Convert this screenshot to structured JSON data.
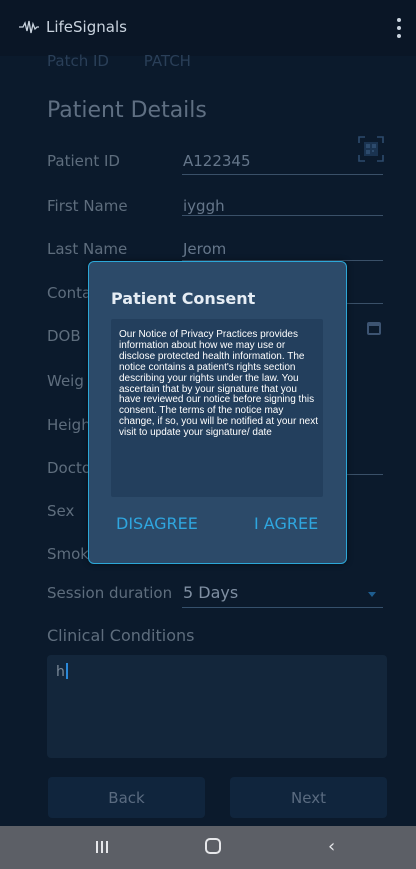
{
  "app": {
    "title": "LifeSignals",
    "logo_icon": "waveform-icon",
    "menu_icon": "more-vert-icon"
  },
  "patch": {
    "label": "Patch ID",
    "value": "PATCH"
  },
  "form": {
    "section_title": "Patient Details",
    "fields": [
      {
        "label": "Patient ID",
        "value": "A122345"
      },
      {
        "label": "First Name",
        "value": "iyggh"
      },
      {
        "label": "Last Name",
        "value": "Jerom"
      },
      {
        "label": "Conta",
        "value": ""
      },
      {
        "label": "DOB",
        "value": ""
      },
      {
        "label": "Weig",
        "value": ""
      },
      {
        "label": "Heigh",
        "value": ""
      },
      {
        "label": "Docto",
        "value": ""
      },
      {
        "label": "Sex",
        "value": ""
      },
      {
        "label": "Smok",
        "value": ""
      }
    ],
    "session_duration": {
      "label": "Session duration",
      "value": "5 Days"
    },
    "clinical_conditions": {
      "label": "Clinical Conditions",
      "value": "h"
    }
  },
  "buttons": {
    "back": "Back",
    "next": "Next"
  },
  "dialog": {
    "title": "Patient Consent",
    "text": "Our Notice of Privacy Practices provides information about how we may use or disclose protected health information. The notice contains a patient's rights section describing your rights under the law. You ascertain that by your signature that you have reviewed our notice before signing this consent. The terms of the notice may change, if so, you will be notified at your next visit to update your signature/ date",
    "disagree": "DISAGREE",
    "agree": "I AGREE"
  },
  "colors": {
    "background": "#0b1a2c",
    "accent": "#2fa6df",
    "dialog": "#2c4a69",
    "dialog_border": "#2ca7d8"
  }
}
